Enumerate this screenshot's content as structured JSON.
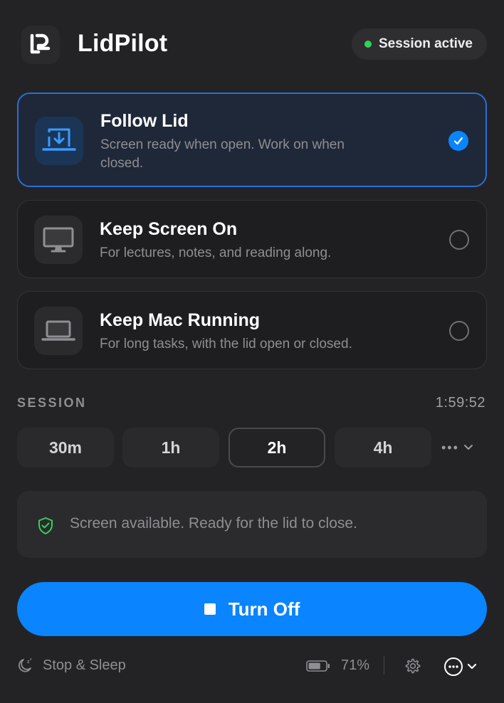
{
  "app": {
    "title": "LidPilot",
    "icon": "lidpilot-logo"
  },
  "status": {
    "label": "Session active",
    "dot_color": "#31d158"
  },
  "modes": [
    {
      "title": "Follow Lid",
      "description": "Screen ready when open. Work on when closed.",
      "icon": "laptop-download-icon",
      "selected": true
    },
    {
      "title": "Keep Screen On",
      "description": "For lectures, notes, and reading along.",
      "icon": "monitor-icon",
      "selected": false
    },
    {
      "title": "Keep Mac Running",
      "description": "For long tasks, with the lid open or closed.",
      "icon": "laptop-icon",
      "selected": false
    }
  ],
  "session": {
    "label": "SESSION",
    "remaining": "1:59:52",
    "durations": [
      "30m",
      "1h",
      "2h",
      "4h"
    ],
    "selected_duration": "2h",
    "more_label": "•••"
  },
  "status_message": {
    "text": "Screen available. Ready for the lid to close.",
    "icon": "shield-check-icon"
  },
  "primary_action": {
    "label": "Turn Off",
    "icon": "stop-icon"
  },
  "footer": {
    "sleep_label": "Stop & Sleep",
    "battery_percent": "71%",
    "battery_level": 0.71
  },
  "colors": {
    "accent": "#0a84ff",
    "success": "#31d158",
    "background": "#232325"
  }
}
